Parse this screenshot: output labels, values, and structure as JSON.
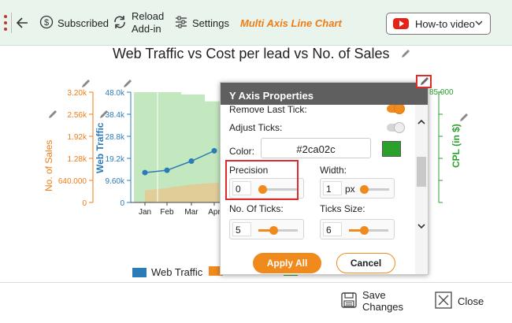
{
  "toolbar": {
    "subscribed_label": "Subscribed",
    "reload_label_line1": "Reload",
    "reload_label_line2": "Add-in",
    "settings_label": "Settings",
    "app_title": "Multi Axis Line Chart",
    "howto_label": "How-to video"
  },
  "chart": {
    "title": "Web Traffic vs Cost per lead vs No. of Sales"
  },
  "chart_data": {
    "type": "line",
    "title": "Web Traffic vs Cost per lead vs No. of Sales",
    "categories": [
      "Jan",
      "Feb",
      "Mar",
      "Apr"
    ],
    "axes": {
      "sales": {
        "label": "No. of Sales",
        "ticks": [
          "0",
          "640.000",
          "1.28k",
          "1.92k",
          "2.56k",
          "3.20k"
        ],
        "color": "#f07c16",
        "range": [
          0,
          3200
        ]
      },
      "traffic": {
        "label": "Web Traffic",
        "ticks": [
          "0",
          "9.60k",
          "19.2k",
          "28.8k",
          "38.4k",
          "48.0k"
        ],
        "color": "#2b7bb9",
        "range": [
          0,
          48000
        ]
      },
      "cpl": {
        "label": "CPL (in $)",
        "ticks": [
          "85.000"
        ],
        "color": "#2ca02c"
      }
    },
    "series": [
      {
        "name": "Web Traffic",
        "type": "line",
        "values": [
          13000,
          14000,
          18000,
          22500
        ],
        "color": "#2b7bb9"
      },
      {
        "name": "No. of Sales",
        "type": "area",
        "values": [
          350,
          420,
          520,
          580
        ],
        "color": "#f0a24a"
      }
    ],
    "cpl_bars": [
      48000,
      48000,
      47000,
      44000,
      41000
    ],
    "grid": false
  },
  "legend": {
    "web_traffic": "Web Traffic"
  },
  "dialog": {
    "title": "Y Axis Properties",
    "remove_last_tick_label": "Remove Last Tick:",
    "adjust_ticks_label": "Adjust Ticks:",
    "color_label": "Color:",
    "color_value": "#2ca02c",
    "precision_label": "Precision",
    "precision_value": "0",
    "width_label": "Width:",
    "width_value": "1",
    "width_unit": "px",
    "no_of_ticks_label": "No. Of Ticks:",
    "no_of_ticks_value": "5",
    "ticks_size_label": "Ticks Size:",
    "ticks_size_value": "6",
    "apply_label": "Apply All",
    "cancel_label": "Cancel"
  },
  "bottom": {
    "save_line1": "Save",
    "save_line2": "Changes",
    "close_label": "Close"
  }
}
